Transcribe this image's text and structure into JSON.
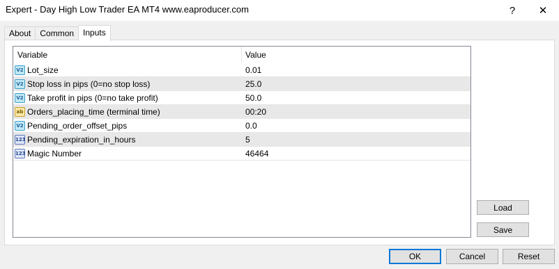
{
  "window": {
    "title": "Expert - Day High Low Trader EA MT4 www.eaproducer.com",
    "help_glyph": "?",
    "close_glyph": "✕"
  },
  "tabs": [
    {
      "label": "About",
      "active": false
    },
    {
      "label": "Common",
      "active": false
    },
    {
      "label": "Inputs",
      "active": true
    }
  ],
  "grid": {
    "columns": [
      "Variable",
      "Value"
    ],
    "rows": [
      {
        "icon": "double-value-icon",
        "icon_text": "V2",
        "variable": "Lot_size",
        "value": "0.01"
      },
      {
        "icon": "double-value-icon",
        "icon_text": "V2",
        "variable": "Stop loss in pips (0=no stop loss)",
        "value": "25.0"
      },
      {
        "icon": "double-value-icon",
        "icon_text": "V2",
        "variable": "Take profit in pips (0=no take profit)",
        "value": "50.0"
      },
      {
        "icon": "string-value-icon",
        "icon_text": "ab",
        "variable": "Orders_placing_time (terminal time)",
        "value": "00:20"
      },
      {
        "icon": "double-value-icon",
        "icon_text": "V2",
        "variable": "Pending_order_offset_pips",
        "value": "0.0"
      },
      {
        "icon": "integer-value-icon",
        "icon_text": "123",
        "variable": "Pending_expiration_in_hours",
        "value": "5"
      },
      {
        "icon": "integer-value-icon",
        "icon_text": "123",
        "variable": "Magic Number",
        "value": "46464"
      }
    ]
  },
  "buttons": {
    "load": "Load",
    "save": "Save",
    "ok": "OK",
    "cancel": "Cancel",
    "reset": "Reset"
  },
  "colors": {
    "window_bg": "#f0f0f0",
    "panel_bg": "#ffffff",
    "row_alt": "#e8e8e8",
    "ok_border": "#0078d7"
  }
}
